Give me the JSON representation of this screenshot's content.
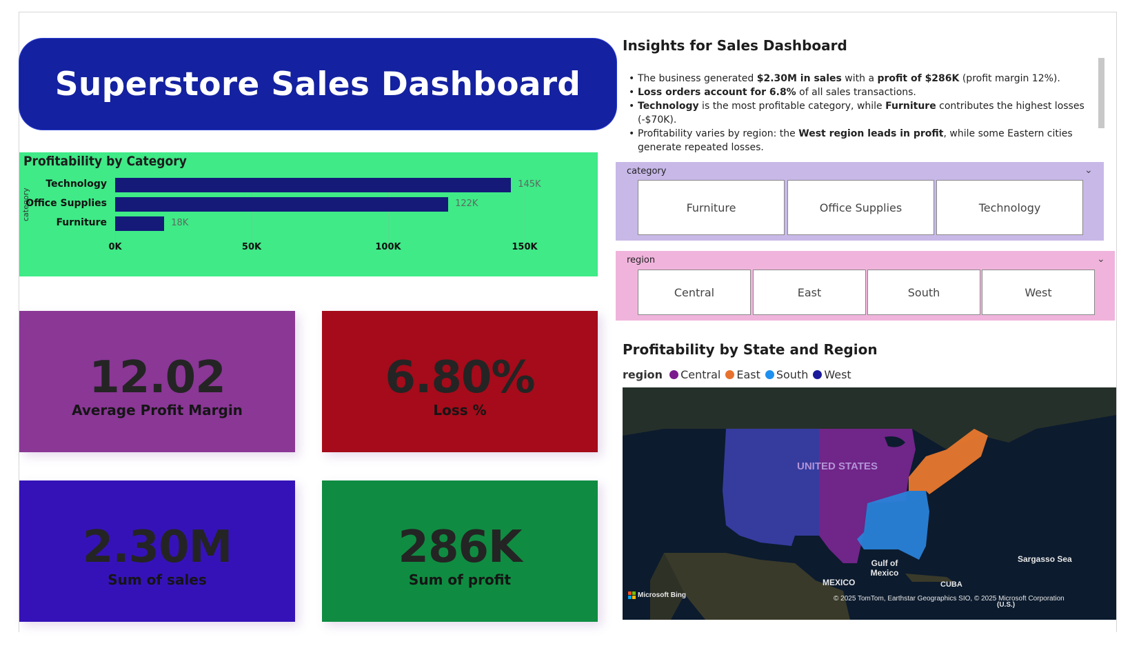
{
  "header": {
    "title": "Superstore Sales Dashboard"
  },
  "category_chart": {
    "title": "Profitability by Category",
    "axis_label": "category"
  },
  "chart_data": {
    "type": "bar",
    "orientation": "horizontal",
    "title": "Profitability by Category",
    "ylabel": "category",
    "xlabel": "",
    "categories": [
      "Technology",
      "Office Supplies",
      "Furniture"
    ],
    "values": [
      145000,
      122000,
      18000
    ],
    "value_labels": [
      "145K",
      "122K",
      "18K"
    ],
    "xlim": [
      0,
      150000
    ],
    "x_ticks": [
      "0K",
      "50K",
      "100K",
      "150K"
    ],
    "x_tick_values": [
      0,
      50000,
      100000,
      150000
    ],
    "bar_color": "#151a79",
    "background": "#3fea87",
    "grid": true
  },
  "kpis": {
    "margin": {
      "value": "12.02",
      "label": "Average Profit Margin",
      "color": "#8a3796"
    },
    "loss": {
      "value": "6.80%",
      "label": "Loss %",
      "color": "#a50b1a"
    },
    "sales": {
      "value": "2.30M",
      "label": "Sum of sales",
      "color": "#3512b8"
    },
    "profit": {
      "value": "286K",
      "label": "Sum of profit",
      "color": "#0f8c41"
    }
  },
  "insights": {
    "title": "Insights for Sales Dashboard",
    "items": [
      {
        "pre": "The business generated ",
        "b1": "$2.30M in sales",
        "mid": " with a ",
        "b2": "profit of $286K",
        "post": " (profit margin 12%)."
      },
      {
        "pre": "",
        "b1": "Loss orders account for 6.8%",
        "mid": " of all sales transactions.",
        "b2": "",
        "post": ""
      },
      {
        "pre": "",
        "b1": "Technology",
        "mid": " is the most profitable category, while ",
        "b2": "Furniture",
        "post": " contributes the highest losses (-$70K)."
      },
      {
        "pre": "Profitability varies by region: the ",
        "b1": "West region leads in profit",
        "mid": ", while some Eastern cities generate repeated losses.",
        "b2": "",
        "post": ""
      }
    ]
  },
  "category_slicer": {
    "title": "category",
    "options": [
      "Furniture",
      "Office Supplies",
      "Technology"
    ],
    "color": "#c8b8e8"
  },
  "region_slicer": {
    "title": "region",
    "options": [
      "Central",
      "East",
      "South",
      "West"
    ],
    "color": "#f0b4dc"
  },
  "map": {
    "title": "Profitability by State and Region",
    "legend_title": "region",
    "legend": [
      {
        "name": "Central",
        "color": "#7b1a8e"
      },
      {
        "name": "East",
        "color": "#e8712e"
      },
      {
        "name": "South",
        "color": "#1e90f0"
      },
      {
        "name": "West",
        "color": "#1a1a9a"
      }
    ],
    "labels": {
      "country": "UNITED STATES",
      "gulf": "Gulf of Mexico",
      "mexico": "MEXICO",
      "cuba": "CUBA",
      "sea": "Sargasso Sea",
      "us": "(U.S.)",
      "bing": "Microsoft Bing",
      "copyright": "© 2025 TomTom, Earthstar Geographics SIO, © 2025 Microsoft Corporation"
    }
  }
}
